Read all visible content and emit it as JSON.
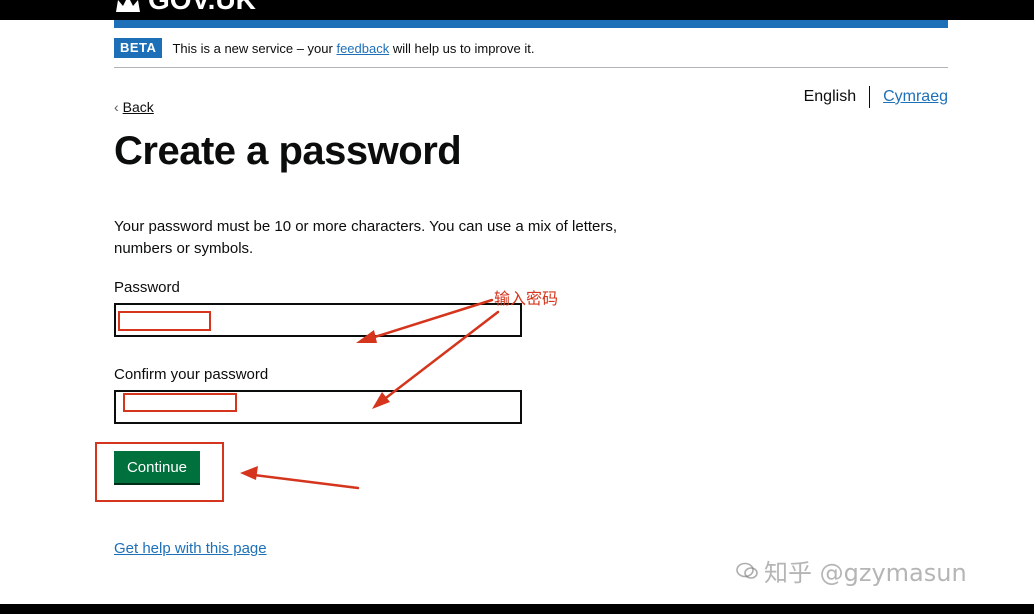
{
  "header": {
    "logo_text": "GOV.UK",
    "brand_color": "#1d70b8"
  },
  "beta_banner": {
    "tag": "BETA",
    "text_before": "This is a new service – your ",
    "link": "feedback",
    "text_after": " will help us to improve it."
  },
  "language": {
    "current": "English",
    "other": "Cymraeg"
  },
  "back": {
    "label": "Back"
  },
  "page": {
    "title": "Create a password",
    "hint": "Your password must be 10 or more characters. You can use a mix of letters, numbers or symbols."
  },
  "form": {
    "password_label": "Password",
    "password_value": "",
    "confirm_label": "Confirm your password",
    "confirm_value": "",
    "continue_label": "Continue",
    "button_color": "#00703c"
  },
  "annotation": {
    "text": "输入密码",
    "color": "#d4351c"
  },
  "footer": {
    "help_link": "Get help with this page"
  },
  "watermark": {
    "text": "知乎 @gzymasun"
  }
}
